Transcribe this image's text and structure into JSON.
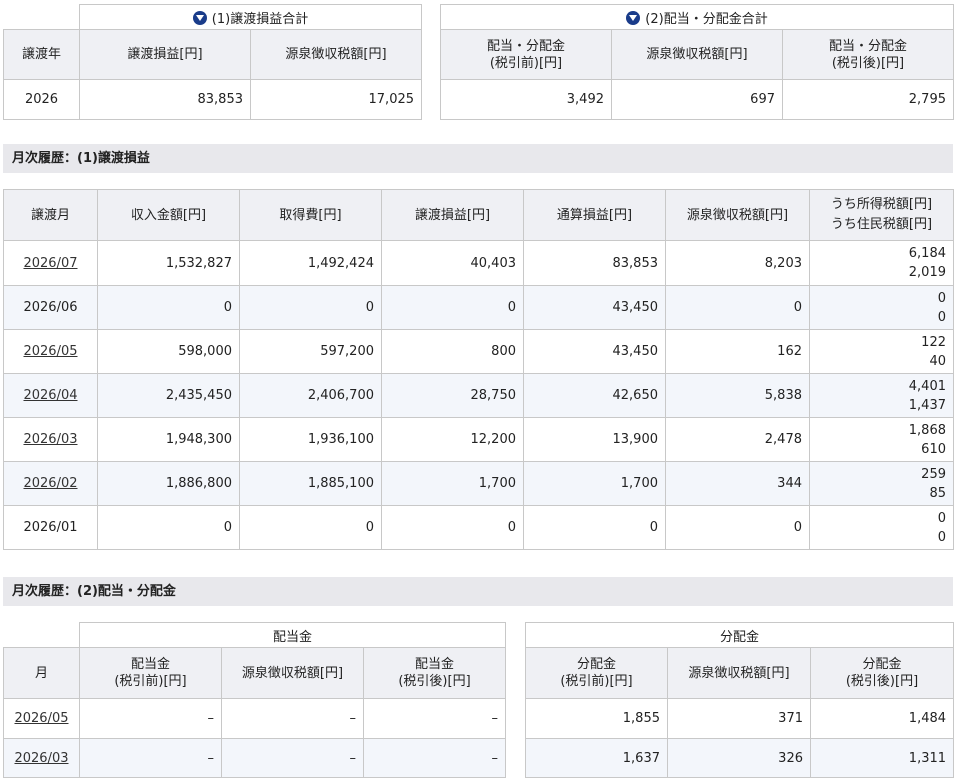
{
  "summary": {
    "col_year": "譲渡年",
    "transfer_group": "(1)譲渡損益合計",
    "dividend_group": "(2)配当・分配金合計",
    "transfer_headers": [
      "譲渡損益[円]",
      "源泉徴収税額[円]"
    ],
    "dividend_headers": [
      [
        "配当・分配金",
        "(税引前)[円]"
      ],
      [
        "源泉徴収税額[円]"
      ],
      [
        "配当・分配金",
        "(税引後)[円]"
      ]
    ],
    "row": {
      "year": "2026",
      "transfer_pl": "83,853",
      "transfer_tax": "17,025",
      "div_before": "3,492",
      "div_tax": "697",
      "div_after": "2,795"
    }
  },
  "monthly_transfer": {
    "section_title": "月次履歴：(1)譲渡損益",
    "headers": [
      "譲渡月",
      "収入金額[円]",
      "取得費[円]",
      "譲渡損益[円]",
      "通算損益[円]",
      "源泉徴収税額[円]"
    ],
    "header_last": [
      "うち所得税額[円]",
      "うち住民税額[円]"
    ],
    "rows": [
      {
        "month": "2026/07",
        "link": true,
        "income": "1,532,827",
        "cost": "1,492,424",
        "pl": "40,403",
        "total": "83,853",
        "tax": "8,203",
        "income_tax": "6,184",
        "resident_tax": "2,019"
      },
      {
        "month": "2026/06",
        "link": false,
        "income": "0",
        "cost": "0",
        "pl": "0",
        "total": "43,450",
        "tax": "0",
        "income_tax": "0",
        "resident_tax": "0"
      },
      {
        "month": "2026/05",
        "link": true,
        "income": "598,000",
        "cost": "597,200",
        "pl": "800",
        "total": "43,450",
        "tax": "162",
        "income_tax": "122",
        "resident_tax": "40"
      },
      {
        "month": "2026/04",
        "link": true,
        "income": "2,435,450",
        "cost": "2,406,700",
        "pl": "28,750",
        "total": "42,650",
        "tax": "5,838",
        "income_tax": "4,401",
        "resident_tax": "1,437"
      },
      {
        "month": "2026/03",
        "link": true,
        "income": "1,948,300",
        "cost": "1,936,100",
        "pl": "12,200",
        "total": "13,900",
        "tax": "2,478",
        "income_tax": "1,868",
        "resident_tax": "610"
      },
      {
        "month": "2026/02",
        "link": true,
        "income": "1,886,800",
        "cost": "1,885,100",
        "pl": "1,700",
        "total": "1,700",
        "tax": "344",
        "income_tax": "259",
        "resident_tax": "85"
      },
      {
        "month": "2026/01",
        "link": false,
        "income": "0",
        "cost": "0",
        "pl": "0",
        "total": "0",
        "tax": "0",
        "income_tax": "0",
        "resident_tax": "0"
      }
    ]
  },
  "monthly_dividend": {
    "section_title": "月次履歴：(2)配当・分配金",
    "col_month": "月",
    "group_dividend": "配当金",
    "group_distribution": "分配金",
    "dividend_headers": [
      [
        "配当金",
        "(税引前)[円]"
      ],
      [
        "源泉徴収税額[円]"
      ],
      [
        "配当金",
        "(税引後)[円]"
      ]
    ],
    "distribution_headers": [
      [
        "分配金",
        "(税引前)[円]"
      ],
      [
        "源泉徴収税額[円]"
      ],
      [
        "分配金",
        "(税引後)[円]"
      ]
    ],
    "rows": [
      {
        "month": "2026/05",
        "d_before": "–",
        "d_tax": "–",
        "d_after": "–",
        "s_before": "1,855",
        "s_tax": "371",
        "s_after": "1,484"
      },
      {
        "month": "2026/03",
        "d_before": "–",
        "d_tax": "–",
        "d_after": "–",
        "s_before": "1,637",
        "s_tax": "326",
        "s_after": "1,311"
      }
    ]
  },
  "icons": {
    "group_toggle": "chevron-down-circle-icon"
  },
  "colors": {
    "accent": "#1a3c8a",
    "header_bg": "#eff0f4",
    "alt_row_bg": "#f3f6fb",
    "section_bg": "#e8e8ec"
  }
}
